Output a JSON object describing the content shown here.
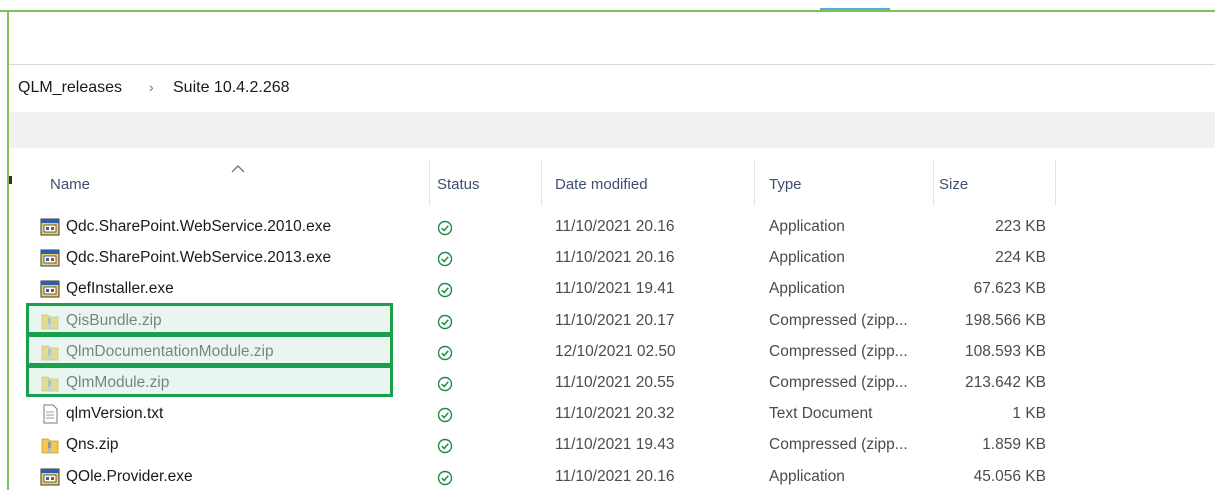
{
  "breadcrumb": {
    "parent": "QLM_releases",
    "separator": "›",
    "current": "Suite 10.4.2.268"
  },
  "columns": {
    "name": "Name",
    "status": "Status",
    "date": "Date modified",
    "type": "Type",
    "size": "Size"
  },
  "files": [
    {
      "name": "Qdc.SharePoint.WebService.2010.exe",
      "icon": "application-icon",
      "status": "synced-check-icon",
      "date": "11/10/2021 20.16",
      "type": "Application",
      "size": "223 KB",
      "highlighted": false
    },
    {
      "name": "Qdc.SharePoint.WebService.2013.exe",
      "icon": "application-icon",
      "status": "synced-check-icon",
      "date": "11/10/2021 20.16",
      "type": "Application",
      "size": "224 KB",
      "highlighted": false
    },
    {
      "name": "QefInstaller.exe",
      "icon": "application-icon",
      "status": "synced-check-icon",
      "date": "11/10/2021 19.41",
      "type": "Application",
      "size": "67.623 KB",
      "highlighted": false
    },
    {
      "name": "QisBundle.zip",
      "icon": "zip-folder-icon",
      "status": "synced-check-icon",
      "date": "11/10/2021 20.17",
      "type": "Compressed (zipp...",
      "size": "198.566 KB",
      "highlighted": true
    },
    {
      "name": "QlmDocumentationModule.zip",
      "icon": "zip-folder-icon",
      "status": "synced-check-icon",
      "date": "12/10/2021 02.50",
      "type": "Compressed (zipp...",
      "size": "108.593 KB",
      "highlighted": true
    },
    {
      "name": "QlmModule.zip",
      "icon": "zip-folder-icon",
      "status": "synced-check-icon",
      "date": "11/10/2021 20.55",
      "type": "Compressed (zipp...",
      "size": "213.642 KB",
      "highlighted": true
    },
    {
      "name": "qlmVersion.txt",
      "icon": "text-file-icon",
      "status": "synced-check-icon",
      "date": "11/10/2021 20.32",
      "type": "Text Document",
      "size": "1 KB",
      "highlighted": false
    },
    {
      "name": "Qns.zip",
      "icon": "zip-folder-icon",
      "status": "synced-check-icon",
      "date": "11/10/2021 19.43",
      "type": "Compressed (zipp...",
      "size": "1.859 KB",
      "highlighted": false
    },
    {
      "name": "QOle.Provider.exe",
      "icon": "application-icon",
      "status": "synced-check-icon",
      "date": "11/10/2021 20.16",
      "type": "Application",
      "size": "45.056 KB",
      "highlighted": false
    }
  ],
  "colors": {
    "highlight": "#1aa04a",
    "status_check": "#1f8a45",
    "window_border": "#7cc35a"
  }
}
